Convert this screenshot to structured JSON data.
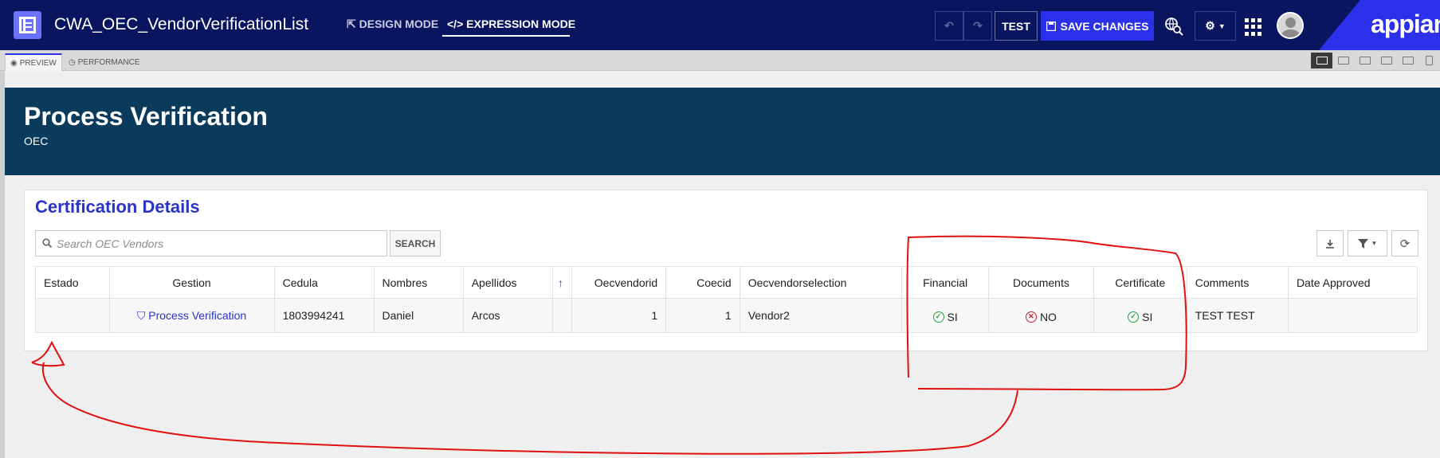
{
  "topbar": {
    "app_title": "CWA_OEC_VendorVerificationList",
    "design_mode": "DESIGN MODE",
    "expression_mode": "EXPRESSION MODE",
    "test_label": "TEST",
    "save_label": "SAVE CHANGES",
    "logo": "appian",
    "icons": [
      "interface-icon",
      "undo-icon",
      "redo-icon",
      "save-icon",
      "globe-search-icon",
      "gear-icon",
      "chevron-down-icon",
      "app-grid-icon",
      "avatar"
    ],
    "accent": "#2c30ea",
    "bar_color": "#0a1560"
  },
  "tabs": {
    "preview": "PREVIEW",
    "performance": "PERFORMANCE"
  },
  "banner": {
    "title": "Process Verification",
    "subtitle": "OEC",
    "color": "#0a3b5c"
  },
  "card": {
    "title": "Certification Details",
    "search_placeholder": "Search OEC Vendors",
    "search_button": "SEARCH",
    "columns": [
      "Estado",
      "Gestion",
      "Cedula",
      "Nombres",
      "Apellidos",
      "",
      "Oecvendorid",
      "Coecid",
      "Oecvendorselection",
      "Financial",
      "Documents",
      "Certificate",
      "Comments",
      "Date Approved"
    ],
    "rows": [
      {
        "estado": "",
        "gestion": "Process Verification",
        "cedula": "1803994241",
        "nombres": "Daniel",
        "apellidos": "Arcos",
        "sort": "",
        "oecvendorid": "1",
        "coecid": "1",
        "oecvendorselection": "Vendor2",
        "financial": "SI",
        "documents": "NO",
        "certificate": "SI",
        "comments": "TEST TEST",
        "date_approved": ""
      }
    ]
  }
}
